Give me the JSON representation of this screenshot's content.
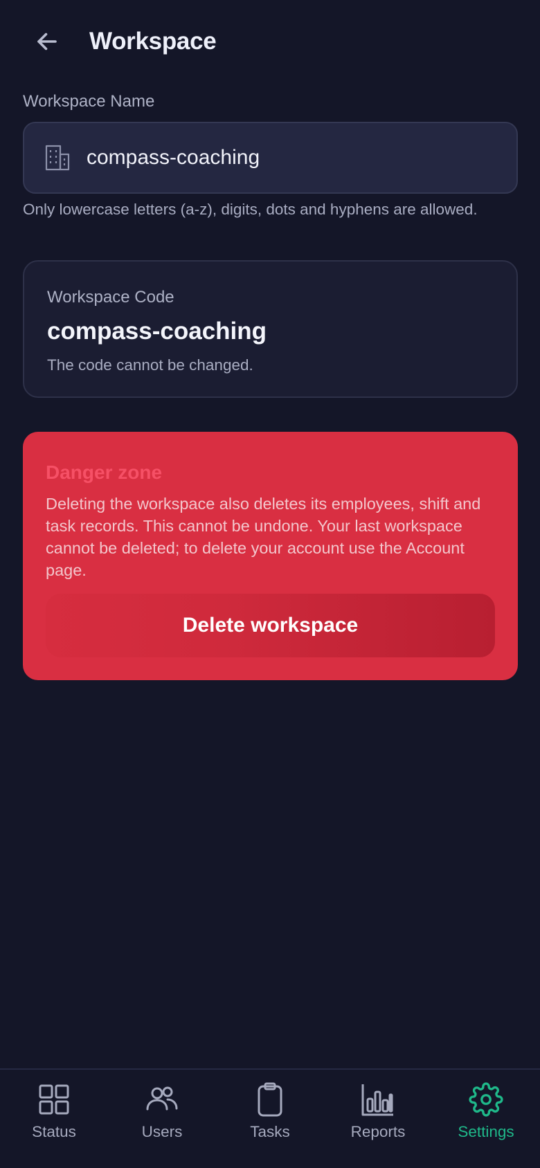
{
  "header": {
    "title": "Workspace",
    "back_icon": "arrow-left-icon"
  },
  "workspace_name": {
    "label": "Workspace Name",
    "value": "compass-coaching",
    "icon": "building-icon",
    "hint": "Only lowercase letters (a-z), digits, dots and hyphens are allowed."
  },
  "workspace_code": {
    "label": "Workspace Code",
    "value": "compass-coaching",
    "note": "The code cannot be changed."
  },
  "danger_zone": {
    "title": "Danger zone",
    "description": "Deleting the workspace also deletes its employees, shift and task records. This cannot be undone. Your last workspace cannot be deleted; to delete your account use the Account page.",
    "delete_label": "Delete workspace"
  },
  "nav": {
    "items": [
      {
        "label": "Status",
        "icon": "grid-icon",
        "active": false
      },
      {
        "label": "Users",
        "icon": "users-icon",
        "active": false
      },
      {
        "label": "Tasks",
        "icon": "clipboard-icon",
        "active": false
      },
      {
        "label": "Reports",
        "icon": "bar-chart-icon",
        "active": false
      },
      {
        "label": "Settings",
        "icon": "gear-icon",
        "active": true
      }
    ]
  },
  "colors": {
    "background": "#141628",
    "accent": "#1fb98a",
    "danger": "#d92f42",
    "danger_title": "#f65066"
  }
}
